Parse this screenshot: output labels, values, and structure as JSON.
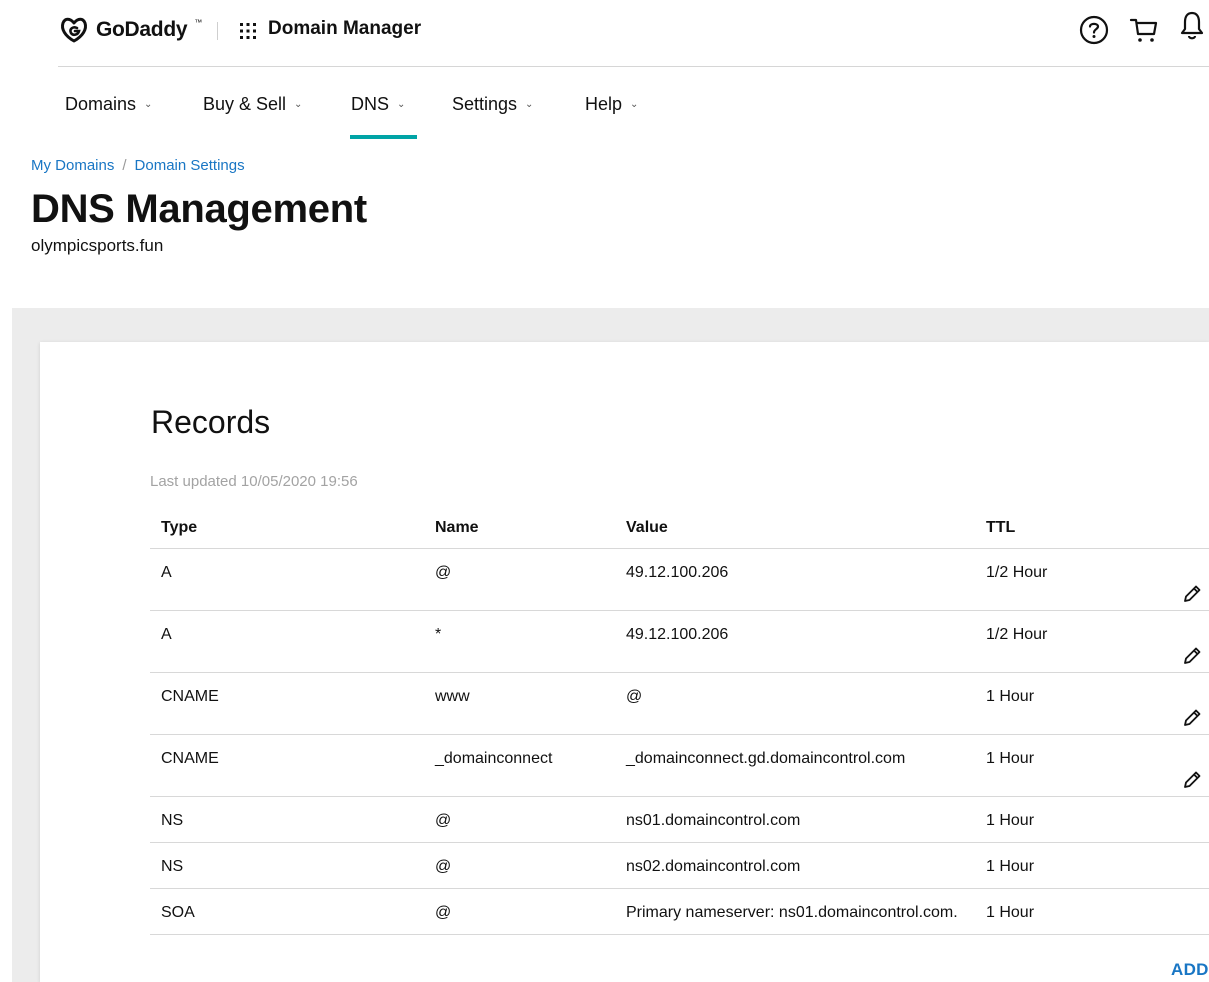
{
  "header": {
    "logo_text": "GoDaddy",
    "logo_tm": "™",
    "app_title": "Domain Manager",
    "apps_icon": "grid-dots-icon",
    "icons": [
      "help-icon",
      "cart-icon",
      "bell-icon"
    ]
  },
  "nav": {
    "items": [
      {
        "label": "Domains"
      },
      {
        "label": "Buy & Sell"
      },
      {
        "label": "DNS"
      },
      {
        "label": "Settings"
      },
      {
        "label": "Help"
      }
    ],
    "active": "DNS",
    "chevron": "⌄"
  },
  "breadcrumb": {
    "items": [
      "My Domains",
      "Domain Settings"
    ],
    "separator": "/"
  },
  "page": {
    "title": "DNS Management",
    "domain": "olympicsports.fun"
  },
  "records": {
    "title": "Records",
    "last_updated": "Last updated 10/05/2020 19:56",
    "columns": [
      "Type",
      "Name",
      "Value",
      "TTL"
    ],
    "rows": [
      {
        "type": "A",
        "name": "@",
        "value": "49.12.100.206",
        "ttl": "1/2 Hour",
        "editable": true
      },
      {
        "type": "A",
        "name": "*",
        "value": "49.12.100.206",
        "ttl": "1/2 Hour",
        "editable": true
      },
      {
        "type": "CNAME",
        "name": "www",
        "value": "@",
        "ttl": "1 Hour",
        "editable": true
      },
      {
        "type": "CNAME",
        "name": "_domainconnect",
        "value": "_domainconnect.gd.domaincontrol.com",
        "ttl": "1 Hour",
        "editable": true
      },
      {
        "type": "NS",
        "name": "@",
        "value": "ns01.domaincontrol.com",
        "ttl": "1 Hour",
        "editable": false
      },
      {
        "type": "NS",
        "name": "@",
        "value": "ns02.domaincontrol.com",
        "ttl": "1 Hour",
        "editable": false
      },
      {
        "type": "SOA",
        "name": "@",
        "value": "Primary nameserver: ns01.domaincontrol.com.",
        "ttl": "1 Hour",
        "editable": false
      }
    ],
    "add_label": "ADD"
  },
  "colors": {
    "link": "#1976c4",
    "nav_active": "#00a4a6",
    "muted": "#a3a3a3",
    "band": "#ececec"
  }
}
